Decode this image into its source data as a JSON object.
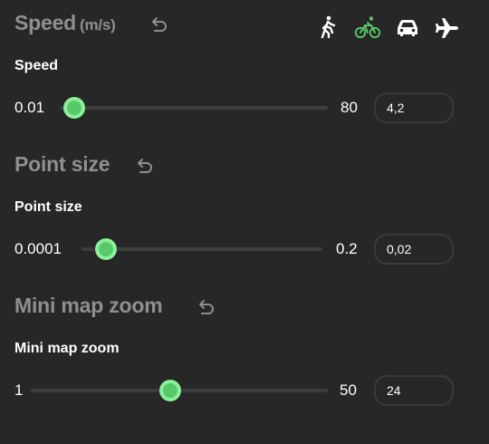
{
  "speed": {
    "title": "Speed",
    "unit": "(m/s)",
    "label": "Speed",
    "min": "0.01",
    "max": "80",
    "value": "4,2",
    "level": 0.0525,
    "modes": [
      {
        "name": "walk",
        "icon": "walking-person-icon",
        "active": false
      },
      {
        "name": "bike",
        "icon": "bicycle-icon",
        "active": true
      },
      {
        "name": "car",
        "icon": "car-icon",
        "active": false
      },
      {
        "name": "plane",
        "icon": "airplane-icon",
        "active": false
      }
    ]
  },
  "point_size": {
    "title": "Point size",
    "label": "Point size",
    "min": "0.0001",
    "max": "0.2",
    "value": "0,02",
    "level": 0.1
  },
  "mini_map_zoom": {
    "title": "Mini map zoom",
    "label": "Mini map zoom",
    "min": "1",
    "max": "50",
    "value": "24",
    "level": 0.469
  },
  "colors": {
    "accent": "#58c968",
    "background": "#272727",
    "muted_text": "#8f8f8f"
  }
}
